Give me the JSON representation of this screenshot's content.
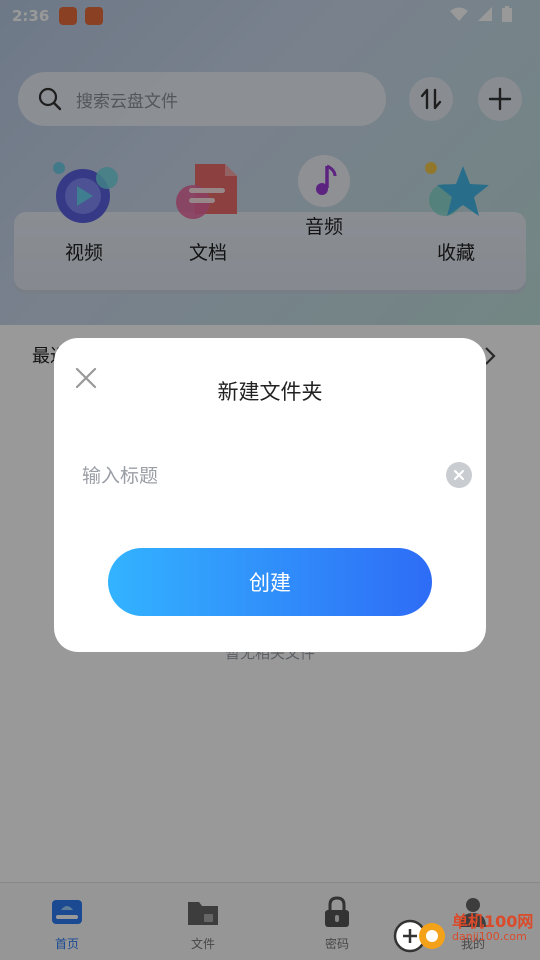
{
  "status_bar": {
    "time": "2:36"
  },
  "search": {
    "placeholder": "搜索云盘文件"
  },
  "categories": [
    {
      "label": "视频",
      "icon": "video-icon"
    },
    {
      "label": "文档",
      "icon": "document-icon"
    },
    {
      "label": "音频",
      "icon": "music-icon"
    },
    {
      "label": "收藏",
      "icon": "star-icon"
    }
  ],
  "recent": {
    "title": "最近"
  },
  "empty_hint": "暂无相关文件",
  "dialog": {
    "title": "新建文件夹",
    "input_placeholder": "输入标题",
    "input_value": "",
    "create_label": "创建"
  },
  "bottom_nav": [
    {
      "label": "首页",
      "icon": "home-disk-icon",
      "active": true
    },
    {
      "label": "文件",
      "icon": "folder-lock-icon",
      "active": false
    },
    {
      "label": "密码",
      "icon": "padlock-icon",
      "active": false
    },
    {
      "label": "我的",
      "icon": "user-icon",
      "active": false
    }
  ],
  "watermark": {
    "text": "单机100网",
    "sub": "danji100.com"
  },
  "colors": {
    "accent": "#2d7cf6",
    "button_start": "#33b3ff",
    "button_end": "#2e6cf6"
  }
}
